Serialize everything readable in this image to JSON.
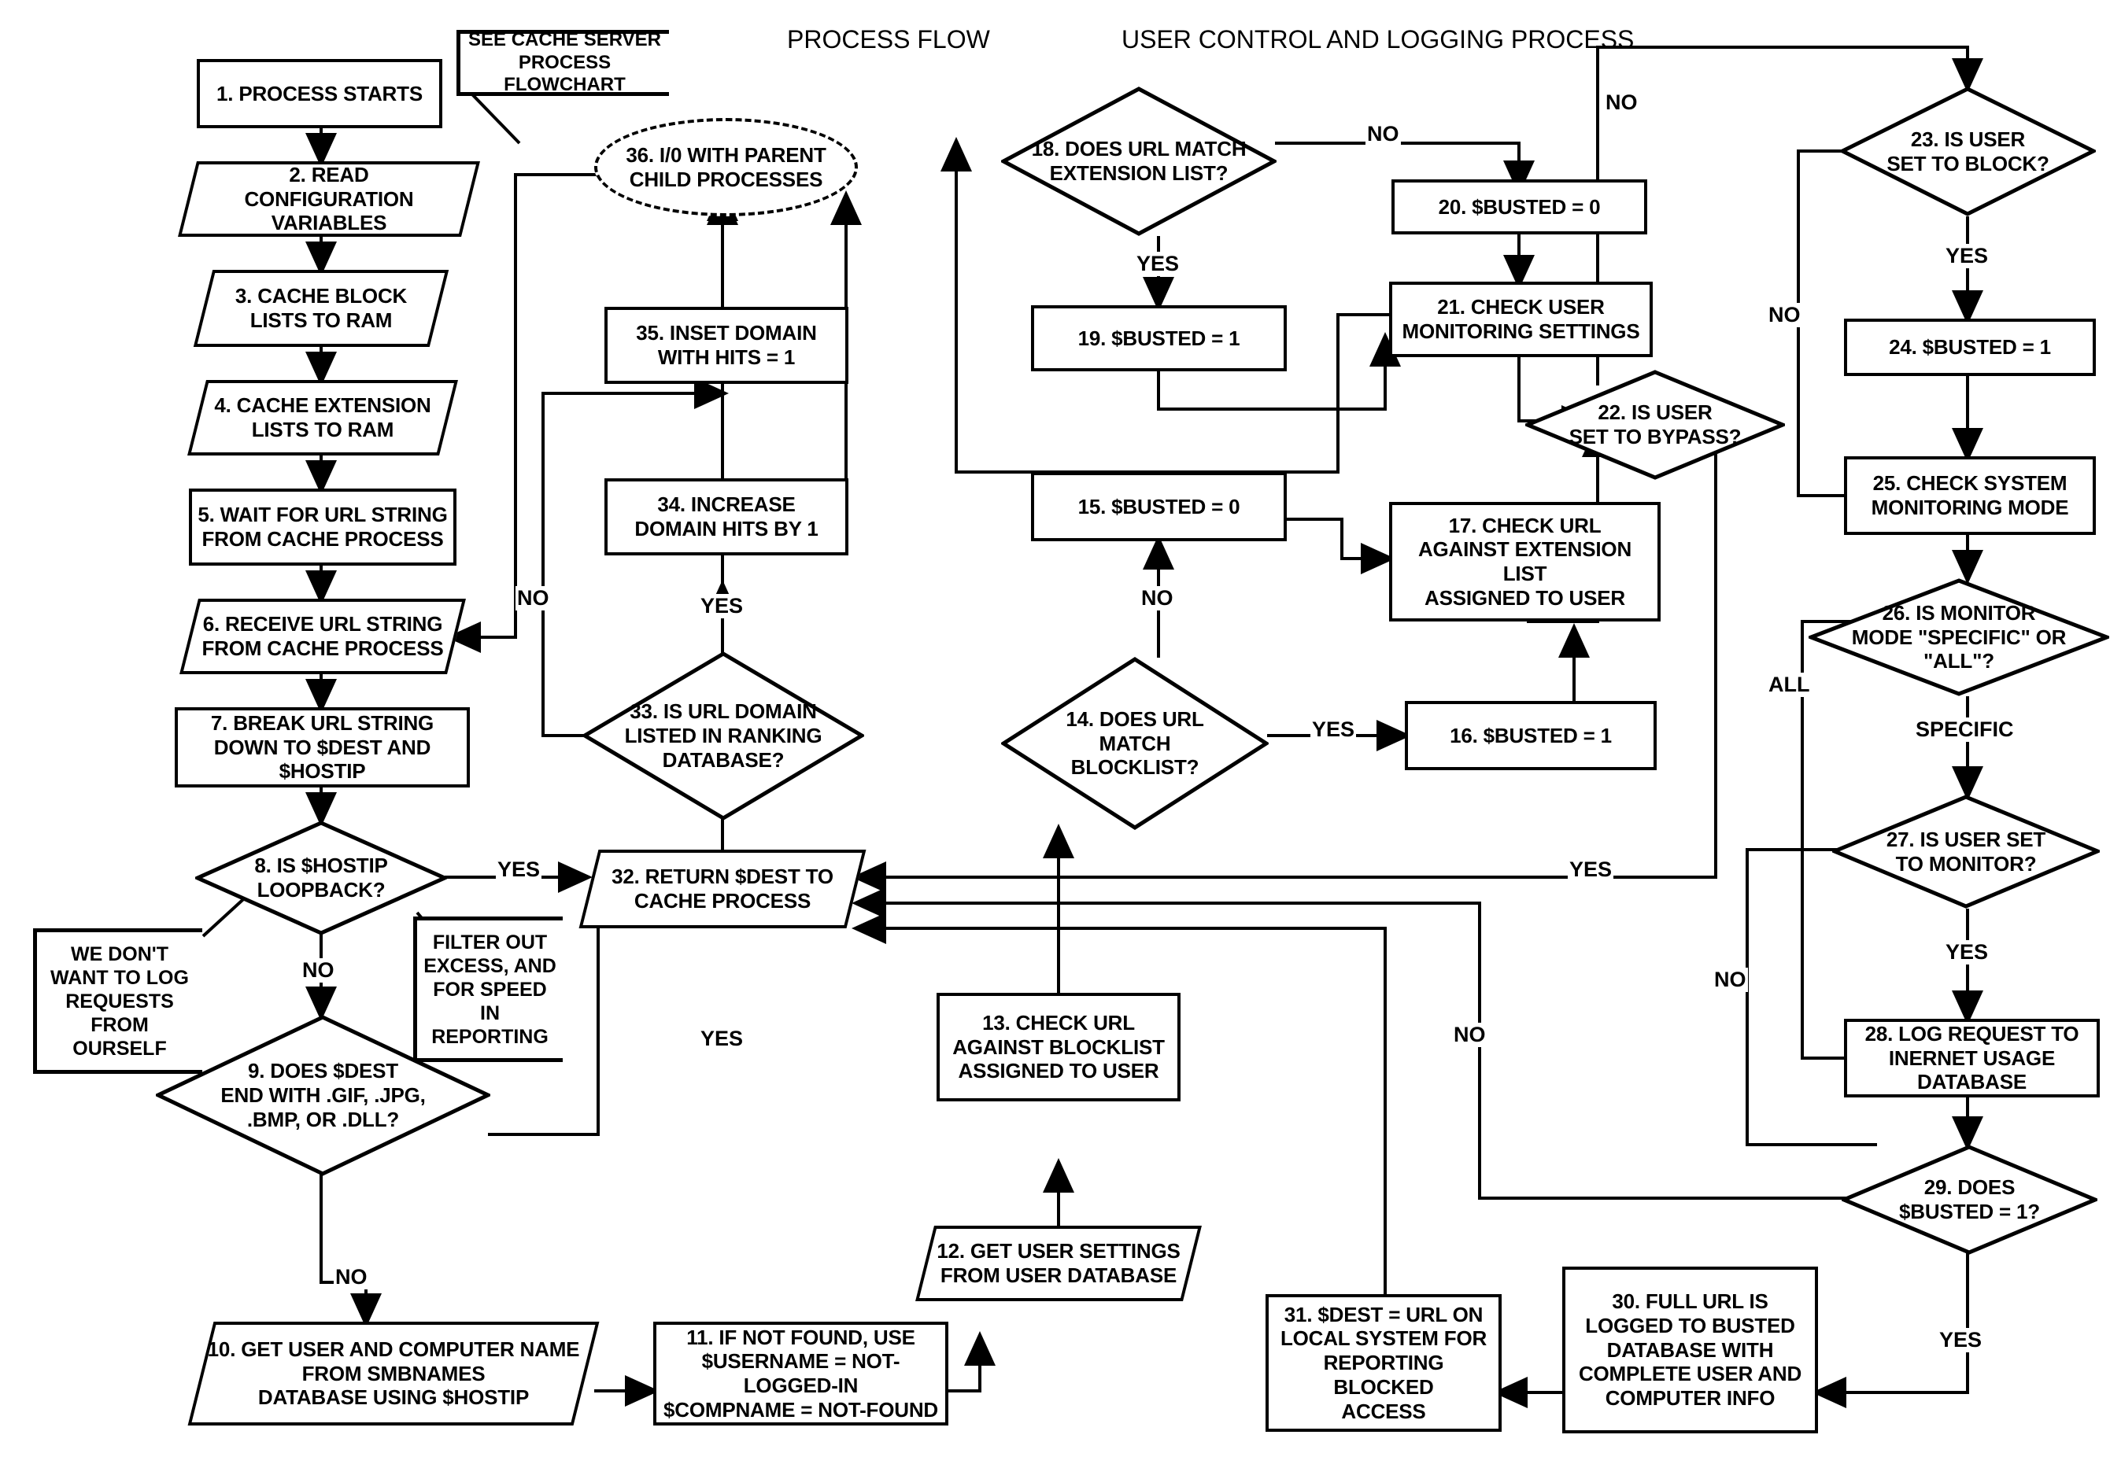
{
  "headers": [
    {
      "id": "process-flow",
      "label": "PROCESS FLOW"
    },
    {
      "id": "user-control-logging",
      "label": "USER CONTROL AND LOGGING PROCESS"
    }
  ],
  "annotations": [
    {
      "id": "see-cache-server",
      "label": "SEE CACHE SERVER\nPROCESS FLOWCHART"
    },
    {
      "id": "we-dont-want-to-log",
      "label": "WE DON'T\nWANT TO LOG\nREQUESTS\nFROM OURSELF"
    },
    {
      "id": "filter-out-excess",
      "label": "FILTER OUT\nEXCESS, AND\nFOR SPEED IN\nREPORTING"
    }
  ],
  "nodes": [
    {
      "id": "n1",
      "shape": "rect",
      "label": "1. PROCESS STARTS"
    },
    {
      "id": "n2",
      "shape": "para",
      "label": "2. READ\nCONFIGURATION VARIABLES"
    },
    {
      "id": "n3",
      "shape": "para",
      "label": "3. CACHE BLOCK\nLISTS TO RAM"
    },
    {
      "id": "n4",
      "shape": "para",
      "label": "4. CACHE EXTENSION\nLISTS TO RAM"
    },
    {
      "id": "n5",
      "shape": "rect",
      "label": "5. WAIT FOR URL STRING\nFROM CACHE PROCESS"
    },
    {
      "id": "n6",
      "shape": "para",
      "label": "6. RECEIVE URL STRING\nFROM CACHE PROCESS"
    },
    {
      "id": "n7",
      "shape": "rect",
      "label": "7. BREAK URL STRING\nDOWN TO $DEST AND $HOSTIP"
    },
    {
      "id": "n8",
      "shape": "diam",
      "label": "8. IS $HOSTIP\nLOOPBACK?"
    },
    {
      "id": "n9",
      "shape": "diam",
      "label": "9. DOES $DEST\nEND WITH .GIF, .JPG,\n.BMP, OR .DLL?"
    },
    {
      "id": "n10",
      "shape": "para",
      "label": "10. GET USER AND COMPUTER NAME\nFROM SMBNAMES\nDATABASE USING $HOSTIP"
    },
    {
      "id": "n11",
      "shape": "rect",
      "label": "11. IF NOT FOUND, USE\n$USERNAME = NOT-LOGGED-IN\n$COMPNAME = NOT-FOUND"
    },
    {
      "id": "n12",
      "shape": "para",
      "label": "12. GET USER SETTINGS\nFROM USER DATABASE"
    },
    {
      "id": "n13",
      "shape": "rect",
      "label": "13. CHECK URL\nAGAINST BLOCKLIST\nASSIGNED TO USER"
    },
    {
      "id": "n14",
      "shape": "diam",
      "label": "14. DOES URL\nMATCH\nBLOCKLIST?"
    },
    {
      "id": "n15",
      "shape": "rect",
      "label": "15. $BUSTED = 0"
    },
    {
      "id": "n16",
      "shape": "rect",
      "label": "16. $BUSTED = 1"
    },
    {
      "id": "n17",
      "shape": "rect",
      "label": "17. CHECK URL\nAGAINST EXTENSION LIST\nASSIGNED TO USER"
    },
    {
      "id": "n18",
      "shape": "diam",
      "label": "18. DOES URL MATCH\nEXTENSION LIST?"
    },
    {
      "id": "n19",
      "shape": "rect",
      "label": "19. $BUSTED = 1"
    },
    {
      "id": "n20",
      "shape": "rect",
      "label": "20. $BUSTED = 0"
    },
    {
      "id": "n21",
      "shape": "rect",
      "label": "21. CHECK USER\nMONITORING SETTINGS"
    },
    {
      "id": "n22",
      "shape": "diam",
      "label": "22. IS USER\nSET TO BYPASS?"
    },
    {
      "id": "n23",
      "shape": "diam",
      "label": "23. IS USER\nSET TO BLOCK?"
    },
    {
      "id": "n24",
      "shape": "rect",
      "label": "24. $BUSTED = 1"
    },
    {
      "id": "n25",
      "shape": "rect",
      "label": "25. CHECK SYSTEM\nMONITORING MODE"
    },
    {
      "id": "n26",
      "shape": "diam",
      "label": "26. IS MONITOR\nMODE \"SPECIFIC\" OR\n\"ALL\"?"
    },
    {
      "id": "n27",
      "shape": "diam",
      "label": "27. IS USER SET\nTO MONITOR?"
    },
    {
      "id": "n28",
      "shape": "rect",
      "label": "28. LOG REQUEST TO\nINERNET USAGE DATABASE"
    },
    {
      "id": "n29",
      "shape": "diam",
      "label": "29. DOES\n$BUSTED = 1?"
    },
    {
      "id": "n30",
      "shape": "rect",
      "label": "30. FULL URL IS\nLOGGED TO BUSTED\nDATABASE WITH\nCOMPLETE USER AND\nCOMPUTER INFO"
    },
    {
      "id": "n31",
      "shape": "rect",
      "label": "31. $DEST = URL ON\nLOCAL SYSTEM FOR\nREPORTING BLOCKED\nACCESS"
    },
    {
      "id": "n32",
      "shape": "para",
      "label": "32. RETURN $DEST TO\nCACHE PROCESS"
    },
    {
      "id": "n33",
      "shape": "diam",
      "label": "33. IS URL DOMAIN\nLISTED IN RANKING\nDATABASE?"
    },
    {
      "id": "n34",
      "shape": "rect",
      "label": "34. INCREASE\nDOMAIN HITS BY 1"
    },
    {
      "id": "n35",
      "shape": "rect",
      "label": "35. INSET DOMAIN\nWITH HITS = 1"
    },
    {
      "id": "n36",
      "shape": "ellipse",
      "label": "36. I/0 WITH PARENT\nCHILD PROCESSES"
    }
  ],
  "edge_labels": [
    {
      "id": "e-8-yes",
      "label": "YES"
    },
    {
      "id": "e-8-no",
      "label": "NO"
    },
    {
      "id": "e-9-no",
      "label": "NO"
    },
    {
      "id": "e-14-no",
      "label": "NO"
    },
    {
      "id": "e-14-yes",
      "label": "YES"
    },
    {
      "id": "e-18-yes",
      "label": "YES"
    },
    {
      "id": "e-18-no",
      "label": "NO"
    },
    {
      "id": "e-22-no",
      "label": "NO"
    },
    {
      "id": "e-22-yes",
      "label": "YES"
    },
    {
      "id": "e-23-yes",
      "label": "YES"
    },
    {
      "id": "e-23-no",
      "label": "NO"
    },
    {
      "id": "e-26-all",
      "label": "ALL"
    },
    {
      "id": "e-26-specific",
      "label": "SPECIFIC"
    },
    {
      "id": "e-27-yes",
      "label": "YES"
    },
    {
      "id": "e-27-no",
      "label": "NO"
    },
    {
      "id": "e-29-yes",
      "label": "YES"
    },
    {
      "id": "e-29-no",
      "label": "NO"
    },
    {
      "id": "e-33-yes",
      "label": "YES"
    },
    {
      "id": "e-33-no",
      "label": "NO"
    },
    {
      "id": "e-32-yes",
      "label": "YES"
    }
  ]
}
